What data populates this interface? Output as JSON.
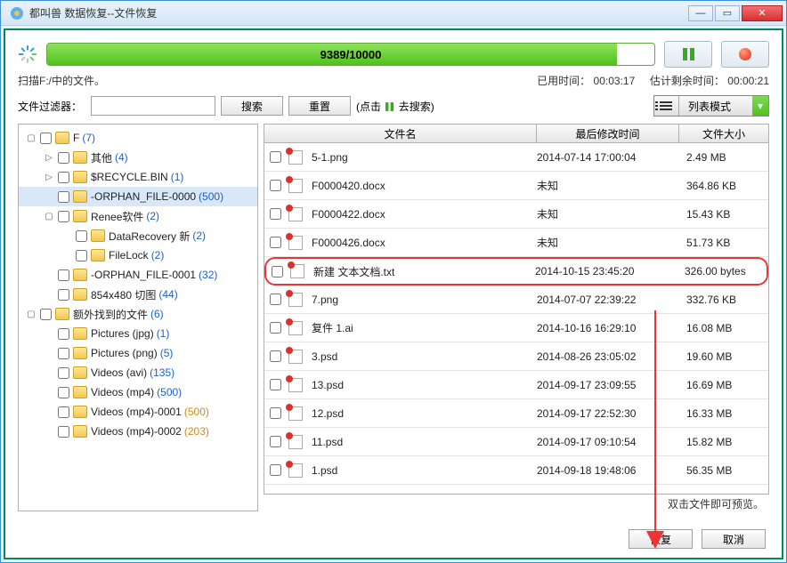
{
  "window": {
    "title": "都叫兽 数据恢复--文件恢复"
  },
  "progress": {
    "text": "9389/10000",
    "percent": 93.89
  },
  "status": {
    "scanning": "扫描F:/中的文件。",
    "elapsed_label": "已用时间：",
    "elapsed_value": "00:03:17",
    "remain_label": "估计剩余时间：",
    "remain_value": "00:00:21"
  },
  "filter": {
    "label": "文件过滤器：",
    "search_btn": "搜索",
    "reset_btn": "重置",
    "hint_prefix": "(点击 ",
    "hint_suffix": " 去搜索)"
  },
  "viewmode": {
    "label": "列表模式"
  },
  "filecols": {
    "name": "文件名",
    "date": "最后修改时间",
    "size": "文件大小"
  },
  "count_colors": {
    "blue": "#1a5fd0",
    "orange": "#d08a1a"
  },
  "tree": [
    {
      "depth": 0,
      "exp": "▢",
      "label": "F ",
      "count": "(7)",
      "cc": "blue"
    },
    {
      "depth": 1,
      "exp": "▷",
      "label": "其他 ",
      "count": "(4)",
      "cc": "blue"
    },
    {
      "depth": 1,
      "exp": "▷",
      "label": "$RECYCLE.BIN ",
      "count": "(1)",
      "cc": "blue"
    },
    {
      "depth": 1,
      "exp": "",
      "label": "-ORPHAN_FILE-0000 ",
      "count": "(500)",
      "cc": "blue",
      "selected": true
    },
    {
      "depth": 1,
      "exp": "▢",
      "label": "Renee软件 ",
      "count": "(2)",
      "cc": "blue"
    },
    {
      "depth": 2,
      "exp": "",
      "label": "DataRecovery 新 ",
      "count": "(2)",
      "cc": "blue"
    },
    {
      "depth": 2,
      "exp": "",
      "label": "FileLock ",
      "count": "(2)",
      "cc": "blue"
    },
    {
      "depth": 1,
      "exp": "",
      "label": "-ORPHAN_FILE-0001 ",
      "count": "(32)",
      "cc": "blue"
    },
    {
      "depth": 1,
      "exp": "",
      "label": "854x480 切图 ",
      "count": "(44)",
      "cc": "blue"
    },
    {
      "depth": 0,
      "exp": "▢",
      "label": "额外找到的文件 ",
      "count": "(6)",
      "cc": "blue"
    },
    {
      "depth": 1,
      "exp": "",
      "label": "Pictures (jpg) ",
      "count": "(1)",
      "cc": "blue"
    },
    {
      "depth": 1,
      "exp": "",
      "label": "Pictures (png) ",
      "count": "(5)",
      "cc": "blue"
    },
    {
      "depth": 1,
      "exp": "",
      "label": "Videos (avi) ",
      "count": "(135)",
      "cc": "blue"
    },
    {
      "depth": 1,
      "exp": "",
      "label": "Videos (mp4) ",
      "count": "(500)",
      "cc": "blue"
    },
    {
      "depth": 1,
      "exp": "",
      "label": "Videos (mp4)-0001 ",
      "count": "(500)",
      "cc": "orange"
    },
    {
      "depth": 1,
      "exp": "",
      "label": "Videos (mp4)-0002 ",
      "count": "(203)",
      "cc": "orange"
    }
  ],
  "files": [
    {
      "name": "5-1.png",
      "date": "2014-07-14 17:00:04",
      "size": "2.49 MB"
    },
    {
      "name": "F0000420.docx",
      "date": "未知",
      "size": "364.86 KB"
    },
    {
      "name": "F0000422.docx",
      "date": "未知",
      "size": "15.43 KB"
    },
    {
      "name": "F0000426.docx",
      "date": "未知",
      "size": "51.73 KB"
    },
    {
      "name": "新建 文本文档.txt",
      "date": "2014-10-15 23:45:20",
      "size": "326.00 bytes",
      "highlight": true
    },
    {
      "name": "7.png",
      "date": "2014-07-07 22:39:22",
      "size": "332.76 KB"
    },
    {
      "name": "复件 1.ai",
      "date": "2014-10-16 16:29:10",
      "size": "16.08 MB"
    },
    {
      "name": "3.psd",
      "date": "2014-08-26 23:05:02",
      "size": "19.60 MB"
    },
    {
      "name": "13.psd",
      "date": "2014-09-17 23:09:55",
      "size": "16.69 MB"
    },
    {
      "name": "12.psd",
      "date": "2014-09-17 22:52:30",
      "size": "16.33 MB"
    },
    {
      "name": "11.psd",
      "date": "2014-09-17 09:10:54",
      "size": "15.82 MB"
    },
    {
      "name": "1.psd",
      "date": "2014-09-18 19:48:06",
      "size": "56.35 MB"
    }
  ],
  "hint": "双击文件即可预览。",
  "buttons": {
    "recover": "恢复",
    "cancel": "取消"
  }
}
